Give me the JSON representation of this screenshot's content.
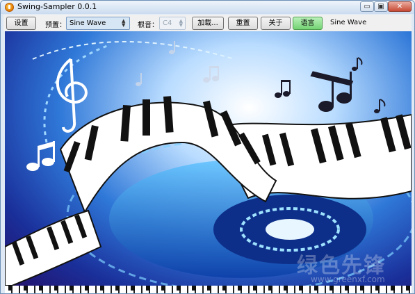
{
  "window": {
    "title": "Swing-Sampler 0.0.1",
    "controls": {
      "minimize": "▭",
      "maximize": "▣",
      "close": "✕"
    }
  },
  "toolbar": {
    "settings_label": "设置",
    "preset_label": "预置：",
    "preset_value": "Sine Wave",
    "root_label": "根音：",
    "root_value": "C4",
    "load_label": "加载...",
    "reset_label": "重置",
    "about_label": "关于",
    "language_label": "语言",
    "status_text": "Sine Wave"
  },
  "colors": {
    "language_button": "#73d373",
    "preset_combo": "#d7e6f4",
    "canvas_deep_blue": "#1a2f9a"
  },
  "canvas": {
    "watermark": "绿色先锋",
    "watermark_url": "www.greenxf.com"
  },
  "icons": [
    "app-logo-icon",
    "treble-clef-icon",
    "music-note-icon",
    "combo-arrows-icon"
  ]
}
